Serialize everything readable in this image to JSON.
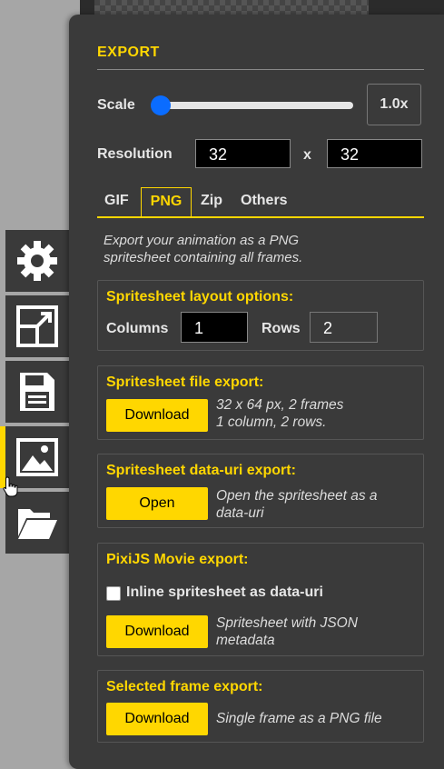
{
  "colors": {
    "accent": "#ffd700",
    "panel_bg": "#3a3a3a",
    "thumb": "#0a6cff"
  },
  "toolbar": {
    "items": [
      {
        "icon": "gear-icon"
      },
      {
        "icon": "resize-icon"
      },
      {
        "icon": "save-icon"
      },
      {
        "icon": "image-icon",
        "active": true
      },
      {
        "icon": "folder-open-icon"
      }
    ]
  },
  "export": {
    "title": "EXPORT",
    "scale_label": "Scale",
    "scale_value": "1.0x",
    "scale_fraction": 0.0,
    "resolution_label": "Resolution",
    "res_width": "32",
    "res_sep": "x",
    "res_height": "32",
    "tabs": [
      {
        "label": "GIF"
      },
      {
        "label": "PNG",
        "selected": true
      },
      {
        "label": "Zip"
      },
      {
        "label": "Others"
      }
    ],
    "description_line1": "Export your animation as a PNG",
    "description_line2": "spritesheet containing all frames."
  },
  "layout_section": {
    "title": "Spritesheet layout options:",
    "columns_label": "Columns",
    "columns_value": "1",
    "rows_label": "Rows",
    "rows_value": "2"
  },
  "file_export": {
    "title": "Spritesheet file export:",
    "button": "Download",
    "note_line1": "32 x 64 px, 2 frames",
    "note_line2": "1 column, 2 rows."
  },
  "datauri_export": {
    "title": "Spritesheet data-uri export:",
    "button": "Open",
    "note_line1": "Open the spritesheet as a",
    "note_line2": "data-uri"
  },
  "pixi_export": {
    "title": "PixiJS Movie export:",
    "checkbox_label": "Inline spritesheet as data-uri",
    "button": "Download",
    "note_line1": "Spritesheet with JSON",
    "note_line2": "metadata"
  },
  "frame_export": {
    "title": "Selected frame export:",
    "button": "Download",
    "note": "Single frame as a PNG file"
  }
}
